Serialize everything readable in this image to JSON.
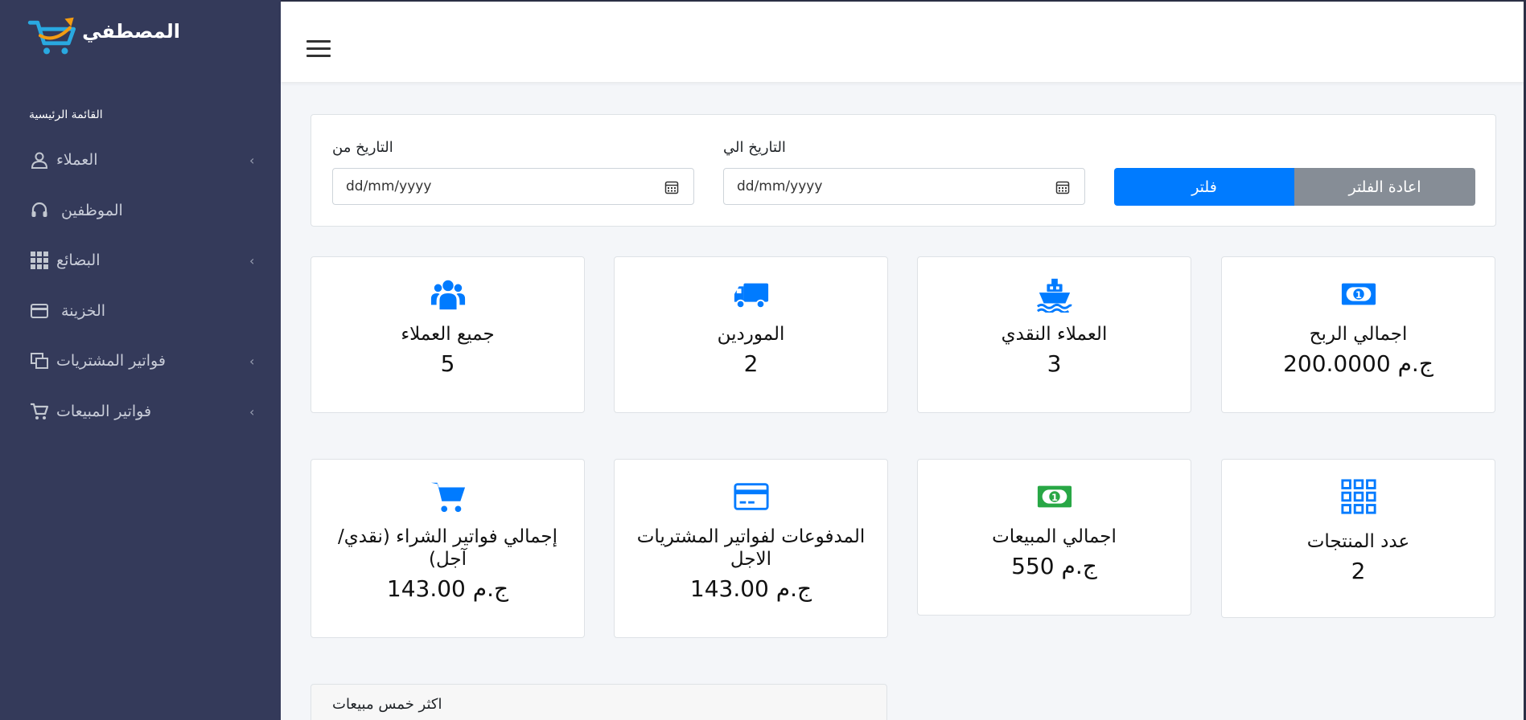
{
  "brand": {
    "name": "المصطفي"
  },
  "sidebar": {
    "header": "القائمة الرئيسية",
    "items": [
      {
        "label": "العملاء",
        "icon": "user-icon",
        "has_submenu": true
      },
      {
        "label": "الموظفين",
        "icon": "headset-icon",
        "has_submenu": false
      },
      {
        "label": "البضائع",
        "icon": "grid-icon",
        "has_submenu": true
      },
      {
        "label": "الخزينة",
        "icon": "credit-card-icon",
        "has_submenu": false
      },
      {
        "label": "فواتير المشتريات",
        "icon": "copy-icon",
        "has_submenu": true
      },
      {
        "label": "فواتير المبيعات",
        "icon": "cart-icon",
        "has_submenu": true
      }
    ]
  },
  "filter": {
    "date_from_label": "التاريخ من",
    "date_from_value": "dd/mm/yyyy",
    "date_to_label": "التاريخ الي",
    "date_to_value": "dd/mm/yyyy",
    "filter_button": "فلتر",
    "reset_button": "اعادة الفلتر"
  },
  "cards": [
    {
      "title": "جميع العملاء",
      "value": "5",
      "icon": "users-icon",
      "color": "#007bff"
    },
    {
      "title": "الموردين",
      "value": "2",
      "icon": "truck-icon",
      "color": "#007bff"
    },
    {
      "title": "العملاء النقدي",
      "value": "3",
      "icon": "ship-icon",
      "color": "#007bff"
    },
    {
      "title": "اجمالي الربح",
      "value": "ج.م 200.0000",
      "icon": "money-bill-icon",
      "color": "#007bff"
    },
    {
      "title": "إجمالي فواتير الشراء (نقدي/آجل)",
      "value": "ج.م 143.00",
      "icon": "cart-icon",
      "color": "#007bff"
    },
    {
      "title": "المدفوعات لفواتير المشتريات الاجل",
      "value": "ج.م 143.00",
      "icon": "credit-card-icon",
      "color": "#007bff"
    },
    {
      "title": "اجمالي المبيعات",
      "value": "ج.م 550",
      "icon": "money-bill-icon",
      "color": "#28a745"
    },
    {
      "title": "عدد المنتجات",
      "value": "2",
      "icon": "grid-icon",
      "color": "#007bff"
    }
  ],
  "top_sales": {
    "title": "اكثر خمس مبيعات"
  },
  "colors": {
    "sidebar": "#343a5a",
    "primary": "#007bff",
    "secondary": "#868d96",
    "success": "#28a745"
  }
}
